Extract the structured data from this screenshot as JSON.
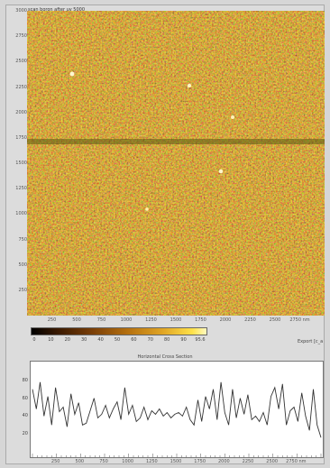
{
  "window": {
    "title": "scan boron after uv 5000"
  },
  "image": {
    "y_ticks": [
      "3000",
      "2750",
      "2500",
      "2250",
      "2000",
      "1750",
      "1500",
      "1250",
      "1000",
      "750",
      "500",
      "250",
      ""
    ],
    "x_ticks": [
      "250",
      "500",
      "750",
      "1000",
      "1250",
      "1500",
      "1750",
      "2000",
      "2250",
      "2500",
      "2750 nm"
    ]
  },
  "colorbar": {
    "ticks": [
      "0",
      "10",
      "20",
      "30",
      "40",
      "50",
      "60",
      "70",
      "80",
      "90",
      "95.6"
    ]
  },
  "export_label": "Export [c_a",
  "profile": {
    "title": "Horizontal Cross Section",
    "y_ticks": [
      "80",
      "60",
      "40",
      "20"
    ],
    "x_ticks": [
      "250",
      "500",
      "750",
      "1000",
      "1250",
      "1500",
      "1750",
      "2000",
      "2250",
      "2500",
      "2750 nm"
    ],
    "chart_data": {
      "type": "line",
      "x": [
        0,
        40,
        80,
        120,
        160,
        200,
        240,
        280,
        320,
        360,
        400,
        440,
        480,
        520,
        560,
        600,
        640,
        680,
        720,
        760,
        800,
        840,
        880,
        920,
        960,
        1000,
        1040,
        1080,
        1120,
        1160,
        1200,
        1240,
        1280,
        1320,
        1360,
        1400,
        1440,
        1480,
        1520,
        1560,
        1600,
        1640,
        1680,
        1720,
        1760,
        1800,
        1840,
        1880,
        1920,
        1960,
        2000,
        2040,
        2080,
        2120,
        2160,
        2200,
        2240,
        2280,
        2320,
        2360,
        2400,
        2440,
        2480,
        2520,
        2560,
        2600,
        2640,
        2680,
        2720,
        2760,
        2800,
        2840,
        2880,
        2920,
        2960,
        3000
      ],
      "y": [
        70,
        48,
        78,
        40,
        62,
        30,
        72,
        45,
        50,
        28,
        65,
        42,
        55,
        30,
        32,
        46,
        60,
        38,
        42,
        52,
        38,
        48,
        56,
        36,
        72,
        42,
        52,
        34,
        38,
        50,
        36,
        46,
        42,
        48,
        40,
        44,
        38,
        42,
        44,
        40,
        50,
        36,
        30,
        58,
        34,
        62,
        48,
        70,
        36,
        78,
        44,
        30,
        70,
        38,
        60,
        42,
        64,
        36,
        40,
        34,
        44,
        30,
        62,
        72,
        48,
        76,
        30,
        46,
        50,
        34,
        66,
        40,
        24,
        70,
        30,
        16
      ],
      "xlim": [
        0,
        3000
      ],
      "ylim": [
        0,
        95
      ]
    }
  }
}
